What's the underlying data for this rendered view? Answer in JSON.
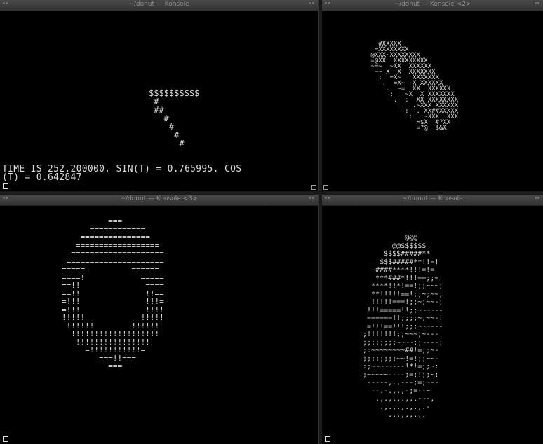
{
  "windows": [
    {
      "title": "~/donut — Konsole"
    },
    {
      "title": "~/donut — Konsole <2>"
    },
    {
      "title": "~/donut — Konsole <3>"
    },
    {
      "title": "~/donut — Konsole"
    }
  ],
  "pane1": {
    "art": "$$$$$$$$$$\n #\n ##\n   #\n    #\n     #\n      #",
    "status": "TIME IS 252.200000. SIN(T) = 0.765995. COS\n(T) = 0.642847"
  },
  "pane2": {
    "art": "   #XXXXX\n  =XXXXXXXX\n @XXX~XXXXXXXX\n =@XX  XXXXXXXXX\n ~=~  ~XX  XXXXXX\n  ~~ X  X  XXXXXXX\n   :  =X~   XXXXXXX\n    .  =X~  X XXXXXX\n     .  ~=  XX  XXXXXX\n      :  .~X  X XXXXXXX\n       .  :  XX XXXXXXXX\n         .  .~XXX XXXXXX\n          :  . XX##XXXXX\n           :  :~XXX  XXX\n             =$X  #?XX\n             =?@  $&X"
  },
  "pane3": {
    "art": "          ===\n      ============\n    ===============\n   ==================\n  ====================\n =====================\n=====          ======\n====!            =====\n==!!              ====\n==!!              !!==\n=!!!              !!!=\n=!!!              !!!!\n!!!!!            !!!!!\n !!!!!!        !!!!!!\n  !!!!!!!!!!!!!!!!!!!\n   !!!!!!!!!!!!!!!!\n     =!!!!!!!!!!!=\n        ===!!===\n          ==="
  },
  "pane4": {
    "art": "          @@@\n       @@$$$$$$\n     $$$$#####**\n    $$$#####**!!=!\n   ####****!!!=!=\n   ***###*!!!==;;=\n  ****!!*!==!;;~~~;\n  **!!!!!==!;;~;~~;\n  !!!!!===!;;~;~~-;\n !!!=====!!;;~~~~--\n ======!!;;;;~;~~-:\n =!!!==!!!;;;~~~---\n;!!!!!!!;;~~~;~---\n;;;;;;;;~~~~;;~---:\n;:~~~~~~~~##!=;;~-\n;;;;;;;;~~!=!;;~~-\n:;~~~~~---!*!=;;~:\n;~~~~~----;=;!;;~:\n -----,.,---;=;~--\n  --.-.,.,-;=--~\n   .,.,.,.,.,-~-,\n    .,.,.,.,.,.-\n      .,.,.,.,."
  }
}
